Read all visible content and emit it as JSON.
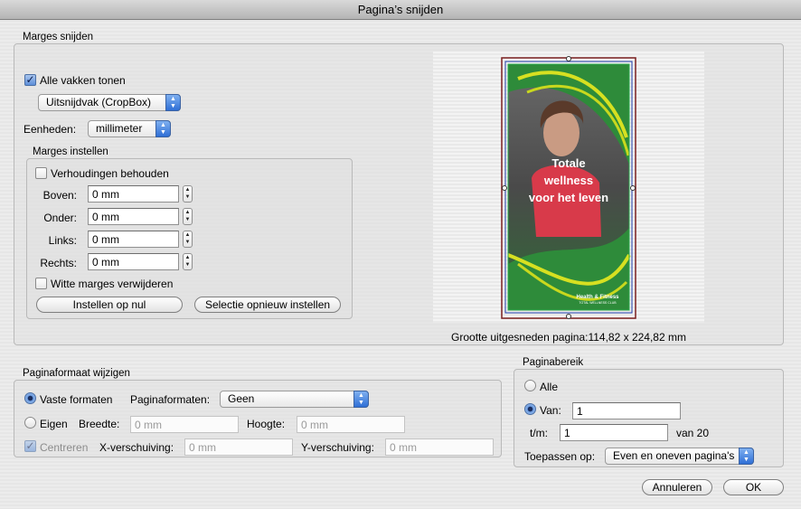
{
  "window": {
    "title": "Pagina’s snijden"
  },
  "marges_snijden": {
    "title": "Marges snijden",
    "show_all_boxes": {
      "label": "Alle vakken tonen",
      "checked": true
    },
    "box_select": {
      "value": "Uitsnijdvak (CropBox)"
    },
    "units": {
      "label": "Eenheden:",
      "value": "millimeter"
    },
    "marges_instellen": {
      "title": "Marges instellen",
      "keep_proportions": {
        "label": "Verhoudingen behouden",
        "checked": false
      },
      "fields": [
        {
          "label": "Boven:",
          "value": "0 mm"
        },
        {
          "label": "Onder:",
          "value": "0 mm"
        },
        {
          "label": "Links:",
          "value": "0 mm"
        },
        {
          "label": "Rechts:",
          "value": "0 mm"
        }
      ],
      "remove_white": {
        "label": "Witte marges verwijderen",
        "checked": false
      },
      "reset_zero_button": "Instellen op nul",
      "reset_selection_button": "Selectie opnieuw instellen"
    },
    "preview": {
      "headline": "Totale wellness voor het leven",
      "logo": "Health & Fitness",
      "logo_sub": "TOTAL WELLNESS CLUB"
    },
    "cropped_size": "Grootte uitgesneden pagina:114,82 x 224,82 mm"
  },
  "paginaformaat": {
    "title": "Paginaformaat wijzigen",
    "fixed": {
      "label": "Vaste formaten",
      "selected": true
    },
    "formats_label": "Paginaformaten:",
    "formats_value": "Geen",
    "custom": {
      "label": "Eigen",
      "selected": false
    },
    "width_label": "Breedte:",
    "width_value": "0 mm",
    "height_label": "Hoogte:",
    "height_value": "0 mm",
    "center": {
      "label": "Centreren",
      "checked": true,
      "disabled": true
    },
    "x_offset_label": "X-verschuiving:",
    "x_offset_value": "0 mm",
    "y_offset_label": "Y-verschuiving:",
    "y_offset_value": "0 mm"
  },
  "paginabereik": {
    "title": "Paginabereik",
    "all": {
      "label": "Alle",
      "selected": false
    },
    "from": {
      "label": "Van:",
      "selected": true,
      "value": "1"
    },
    "to_label": "t/m:",
    "to_value": "1",
    "of_total": "van 20",
    "apply_label": "Toepassen op:",
    "apply_value": "Even en oneven pagina's"
  },
  "buttons": {
    "cancel": "Annuleren",
    "ok": "OK"
  },
  "colors": {
    "accent": "#3b7be0",
    "crop_box": "#7a1f1f",
    "trim_box": "#1a3aa8",
    "bleed_box": "#2aa84a",
    "poster_green": "#2e8b3a"
  },
  "icons": {
    "checkbox": "checkmark",
    "popup": "up-down-arrows-icon",
    "stepper": "up-down-stepper-icon"
  }
}
